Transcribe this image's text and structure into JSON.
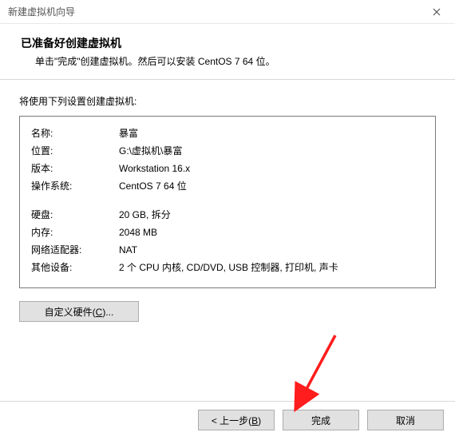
{
  "window": {
    "title": "新建虚拟机向导"
  },
  "header": {
    "title": "已准备好创建虚拟机",
    "sub": "单击\"完成\"创建虚拟机。然后可以安装 CentOS 7 64 位。"
  },
  "section_label": "将使用下列设置创建虚拟机:",
  "summary": {
    "rows1": [
      {
        "key": "名称:",
        "value": "暴富"
      },
      {
        "key": "位置:",
        "value": "G:\\虚拟机\\暴富"
      },
      {
        "key": "版本:",
        "value": "Workstation 16.x"
      },
      {
        "key": "操作系统:",
        "value": "CentOS 7 64 位"
      }
    ],
    "rows2": [
      {
        "key": "硬盘:",
        "value": "20 GB, 拆分"
      },
      {
        "key": "内存:",
        "value": "2048 MB"
      },
      {
        "key": "网络适配器:",
        "value": "NAT"
      },
      {
        "key": "其他设备:",
        "value": "2 个 CPU 内核, CD/DVD, USB 控制器, 打印机, 声卡"
      }
    ]
  },
  "buttons": {
    "customize_prefix": "自定义硬件(",
    "customize_key": "C",
    "customize_suffix": ")...",
    "back_prefix": "< 上一步(",
    "back_key": "B",
    "back_suffix": ")",
    "finish": "完成",
    "cancel": "取消"
  }
}
